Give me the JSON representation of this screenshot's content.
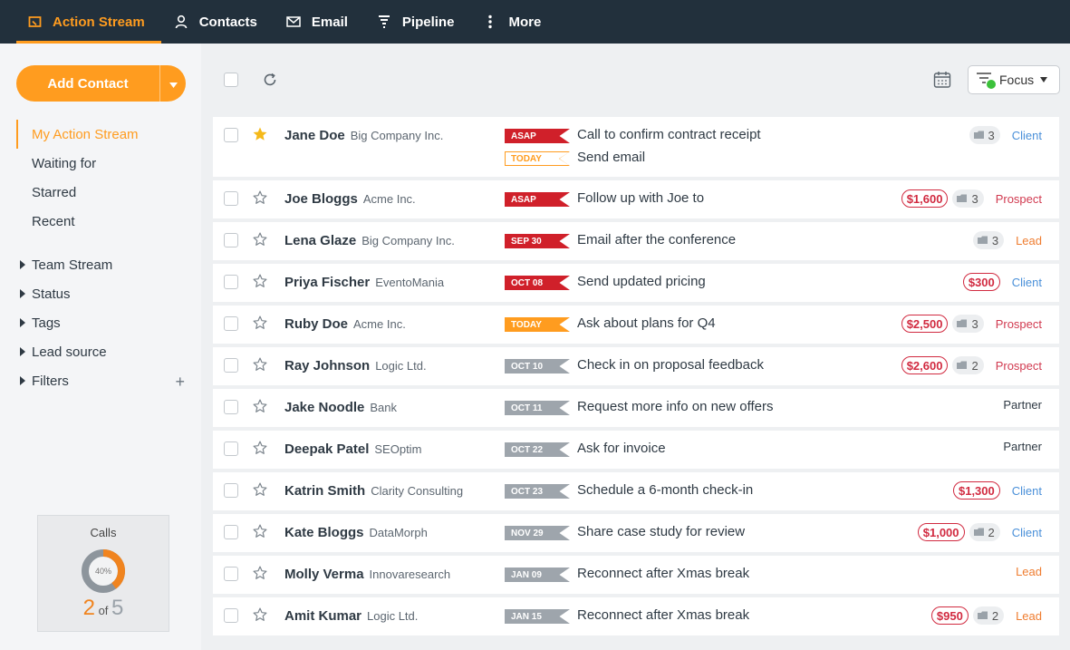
{
  "nav": [
    {
      "label": "Action Stream",
      "icon": "action-stream-icon",
      "active": true
    },
    {
      "label": "Contacts",
      "icon": "contacts-icon"
    },
    {
      "label": "Email",
      "icon": "email-icon"
    },
    {
      "label": "Pipeline",
      "icon": "pipeline-icon"
    },
    {
      "label": "More",
      "icon": "more-icon"
    }
  ],
  "sidebar": {
    "add_contact": "Add Contact",
    "items": [
      "My Action Stream",
      "Waiting for",
      "Starred",
      "Recent"
    ],
    "groups": [
      "Team Stream",
      "Status",
      "Tags",
      "Lead source",
      "Filters"
    ]
  },
  "calls": {
    "title": "Calls",
    "percent": "40%",
    "done": "2",
    "of": "of",
    "total": "5",
    "fraction": 0.4
  },
  "toolbar": {
    "focus_label": "Focus"
  },
  "colors": {
    "accent": "#ff9c1f",
    "topbar": "#22303c",
    "asap": "#d0202a",
    "overdue_grey": "#9ea5ac",
    "client": "#4a90d9",
    "prospect": "#d13a50",
    "lead": "#ef7d30"
  },
  "rows": [
    {
      "name": "Jane Doe",
      "company": "Big Company Inc.",
      "starred": true,
      "tasks": [
        {
          "tag": "ASAP",
          "tag_style": "red",
          "text": "Call to confirm contract receipt"
        },
        {
          "tag": "TODAY",
          "tag_style": "outline",
          "text": "Send email"
        }
      ],
      "amount": "",
      "deals": "3",
      "status": "Client"
    },
    {
      "name": "Joe Bloggs",
      "company": "Acme Inc.",
      "starred": false,
      "tasks": [
        {
          "tag": "ASAP",
          "tag_style": "red",
          "text": "Follow up with Joe to"
        }
      ],
      "amount": "$1,600",
      "deals": "3",
      "status": "Prospect"
    },
    {
      "name": "Lena Glaze",
      "company": "Big Company Inc.",
      "starred": false,
      "tasks": [
        {
          "tag": "SEP 30",
          "tag_style": "red",
          "text": "Email after the conference"
        }
      ],
      "amount": "",
      "deals": "3",
      "status": "Lead"
    },
    {
      "name": "Priya Fischer",
      "company": "EventoMania",
      "starred": false,
      "tasks": [
        {
          "tag": "OCT 08",
          "tag_style": "red",
          "text": "Send updated pricing"
        }
      ],
      "amount": "$300",
      "deals": "",
      "status": "Client"
    },
    {
      "name": "Ruby Doe",
      "company": "Acme Inc.",
      "starred": false,
      "tasks": [
        {
          "tag": "TODAY",
          "tag_style": "orange",
          "text": "Ask about plans for Q4"
        }
      ],
      "amount": "$2,500",
      "deals": "3",
      "status": "Prospect"
    },
    {
      "name": "Ray Johnson",
      "company": "Logic Ltd.",
      "starred": false,
      "tasks": [
        {
          "tag": "OCT 10",
          "tag_style": "grey",
          "text": "Check in on proposal feedback"
        }
      ],
      "amount": "$2,600",
      "deals": "2",
      "status": "Prospect"
    },
    {
      "name": "Jake Noodle",
      "company": "Bank",
      "starred": false,
      "tasks": [
        {
          "tag": "OCT 11",
          "tag_style": "grey",
          "text": "Request more info on new offers"
        }
      ],
      "amount": "",
      "deals": "",
      "status": "Partner"
    },
    {
      "name": "Deepak Patel",
      "company": "SEOptim",
      "starred": false,
      "tasks": [
        {
          "tag": "OCT 22",
          "tag_style": "grey",
          "text": "Ask for invoice"
        }
      ],
      "amount": "",
      "deals": "",
      "status": "Partner"
    },
    {
      "name": "Katrin Smith",
      "company": "Clarity Consulting",
      "starred": false,
      "tasks": [
        {
          "tag": "OCT 23",
          "tag_style": "grey",
          "text": "Schedule a 6-month check-in"
        }
      ],
      "amount": "$1,300",
      "deals": "",
      "status": "Client"
    },
    {
      "name": "Kate Bloggs",
      "company": "DataMorph",
      "starred": false,
      "tasks": [
        {
          "tag": "NOV 29",
          "tag_style": "grey",
          "text": "Share case study for review"
        }
      ],
      "amount": "$1,000",
      "deals": "2",
      "status": "Client"
    },
    {
      "name": "Molly Verma",
      "company": "Innovaresearch",
      "starred": false,
      "tasks": [
        {
          "tag": "JAN 09",
          "tag_style": "grey",
          "text": "Reconnect after Xmas break"
        }
      ],
      "amount": "",
      "deals": "",
      "status": "Lead"
    },
    {
      "name": "Amit Kumar",
      "company": "Logic Ltd.",
      "starred": false,
      "tasks": [
        {
          "tag": "JAN 15",
          "tag_style": "grey",
          "text": "Reconnect after Xmas break"
        }
      ],
      "amount": "$950",
      "deals": "2",
      "status": "Lead"
    }
  ]
}
